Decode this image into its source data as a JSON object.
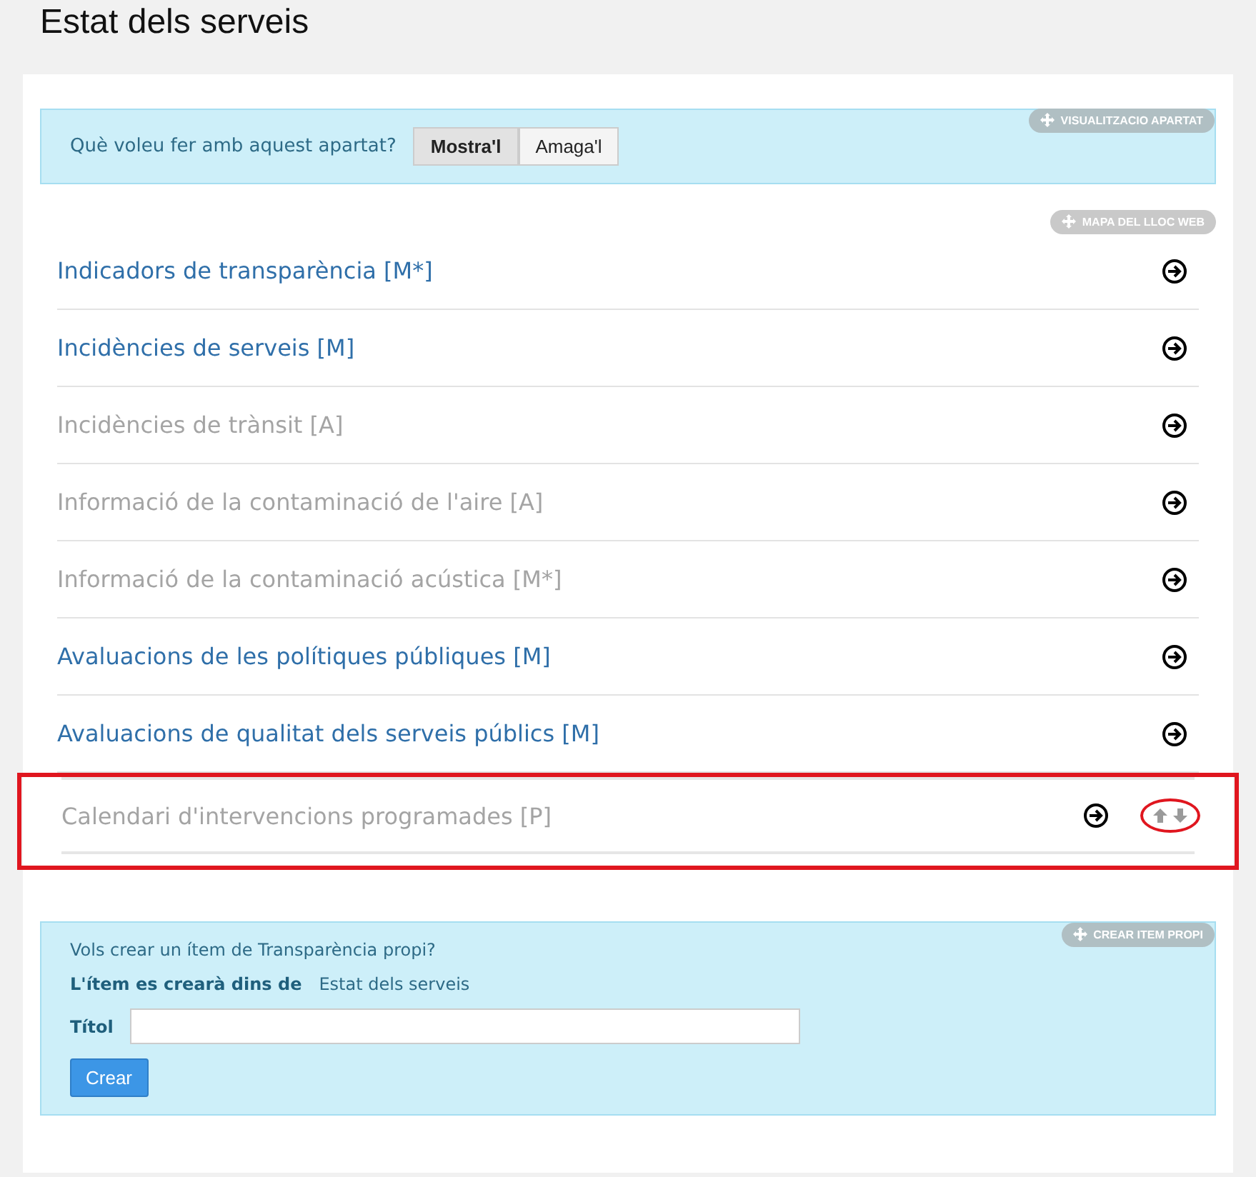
{
  "page_title": "Estat dels serveis",
  "visibility": {
    "badge": "VISUALITZACIO APARTAT",
    "question": "Què voleu fer amb aquest apartat?",
    "options": [
      {
        "label": "Mostra'l",
        "selected": true
      },
      {
        "label": "Amaga'l",
        "selected": false
      }
    ]
  },
  "sitemap": {
    "badge": "MAPA DEL LLOC WEB",
    "items": [
      {
        "label": "Indicadors de transparència [M*]",
        "disabled": false,
        "highlighted": false
      },
      {
        "label": "Incidències de serveis [M]",
        "disabled": false,
        "highlighted": false
      },
      {
        "label": "Incidències de trànsit [A]",
        "disabled": true,
        "highlighted": false
      },
      {
        "label": "Informació de la contaminació de l'aire [A]",
        "disabled": true,
        "highlighted": false
      },
      {
        "label": "Informació de la contaminació acústica [M*]",
        "disabled": true,
        "highlighted": false
      },
      {
        "label": "Avaluacions de les polítiques públiques [M]",
        "disabled": false,
        "highlighted": false
      },
      {
        "label": "Avaluacions de qualitat dels serveis públics [M]",
        "disabled": false,
        "highlighted": false
      },
      {
        "label": "Calendari d'intervencions programades [P]",
        "disabled": true,
        "highlighted": true
      }
    ]
  },
  "create": {
    "badge": "CREAR ITEM PROPI",
    "intro": "Vols crear un ítem de Transparència propi?",
    "location_label": "L'ítem es crearà dins de",
    "location_value": "Estat dels serveis",
    "title_label": "Títol",
    "submit": "Crear"
  }
}
